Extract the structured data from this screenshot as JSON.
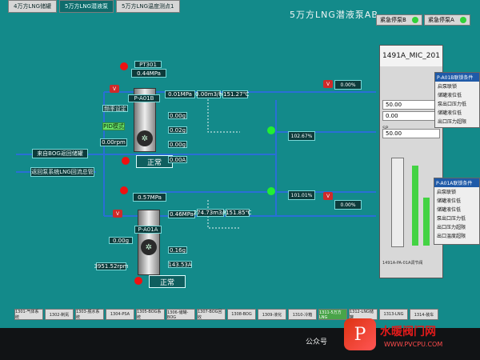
{
  "top_tabs": [
    "4万方LNG储罐",
    "5万方LNG潜液泵",
    "5万方LNG温度测点1"
  ],
  "title": "5万方LNG潜液泵AB",
  "stop_buttons": [
    {
      "label": "紧急停泵B"
    },
    {
      "label": "紧急停泵A"
    }
  ],
  "pump_b": {
    "tag": "P-A01B",
    "pressure_label": "PT301",
    "pressure": "0.44MPa",
    "outlet_pressure": "0.01MPa",
    "flow": "0.00m3/h",
    "temp": "-151.27℃",
    "setting_label": "频率设定",
    "freq_state": "PID模式",
    "speed": "0.00rpm",
    "meas_1": "0.00g",
    "meas_2": "0.02g",
    "meas_3": "0.00g",
    "meas_4": "0.00A",
    "status": "正常"
  },
  "pump_a": {
    "tag": "P-A01A",
    "pressure": "0.57MPa",
    "outlet_pressure": "0.46MPa",
    "flow": "274.73m3/h",
    "temp": "-151.85℃",
    "speed": "3951.52rpm",
    "meas_1": "0.00g",
    "meas_2": "0.16g",
    "current": "143.53A",
    "status": "正常"
  },
  "lines": {
    "bog_return": "来自BOG返回储罐",
    "lng_return": "返回泵系统LNG回流总管"
  },
  "valves": {
    "v_top": {
      "value": "0.00%"
    },
    "v_mid": {
      "value": "102.67%"
    },
    "v_low": {
      "value": "101.01%"
    },
    "v_bottom": {
      "value": "0.00%"
    }
  },
  "faceplate": {
    "title": "1491A_MIC_201",
    "sp": "50.00",
    "pv": "0.00",
    "op": "50.00",
    "footer": "1491A-PA-01A调节阀"
  },
  "right_panel": {
    "title": "P-A01B联锁条件",
    "lines": [
      "启泵联锁",
      "储罐液位低",
      "泵出口压力低",
      "储罐液位低",
      "出口压力超限"
    ]
  },
  "right_panel2": {
    "title": "P-A01A联锁条件",
    "lines": [
      "启泵联锁",
      "储罐液位低",
      "储罐液位低",
      "泵出口压力低",
      "出口压力超限",
      "出口温度超限"
    ]
  },
  "bottom_tabs": [
    "1301-气体系统",
    "1302-制氮",
    "1303-脱水系统",
    "1304-PSA",
    "1305-BOG系统",
    "1306-储罐-BOG",
    "1307-BOG回收",
    "1308-BOG",
    "1309-液化",
    "1310-冷箱",
    "1311-5万方LNG",
    "1312-LNG储罐",
    "1313-LNG",
    "1314-装车"
  ],
  "bottom_tab_active": 10,
  "watermark": {
    "logo": "P",
    "text": "水暖阀门网",
    "url": "WWW.PVCPU.COM",
    "public": "公众号"
  }
}
